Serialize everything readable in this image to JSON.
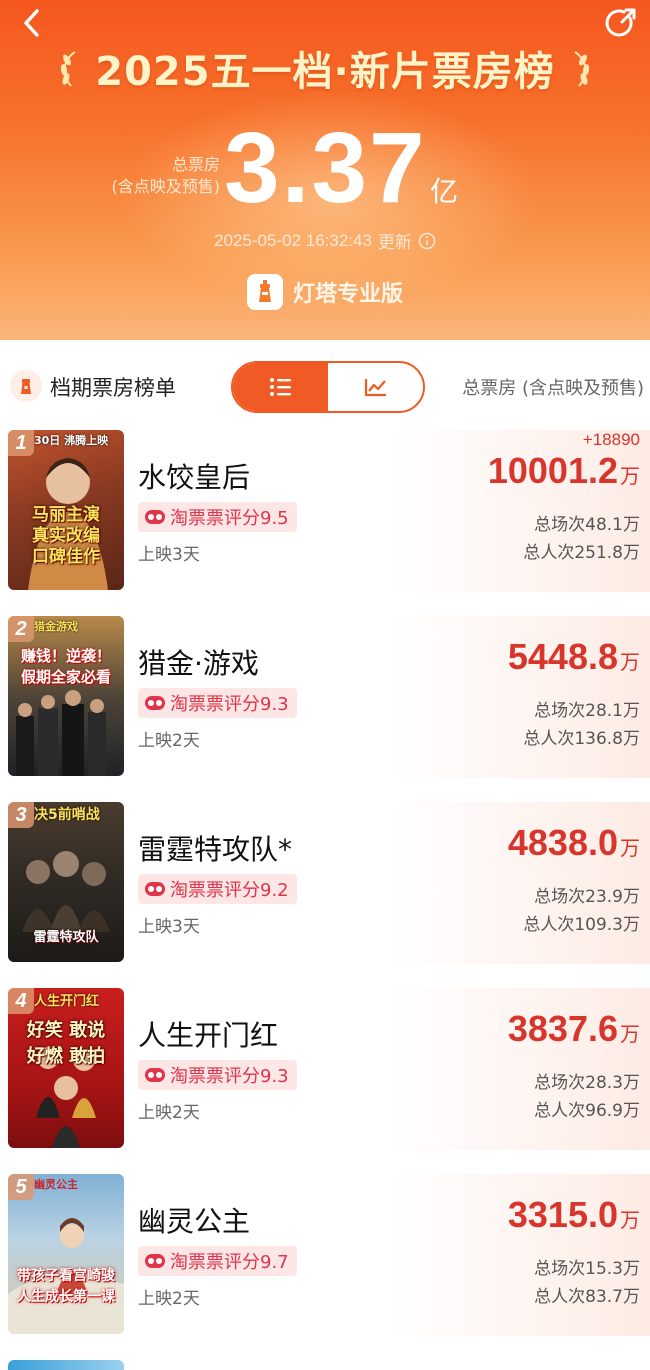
{
  "header": {
    "title": "2025五一档·新片票房榜",
    "total_label_line1": "总票房",
    "total_label_line2": "(含点映及预售)",
    "total_value": "3.37",
    "total_unit": "亿",
    "update_time": "2025-05-02 16:32:43",
    "update_label": "更新",
    "brand": "灯塔专业版"
  },
  "toolbar": {
    "title": "档期票房榜单",
    "column_header": "总票房 (含点映及预售)"
  },
  "colors": {
    "accent": "#f05a24",
    "gross_red": "#d8352c",
    "rating_pink": "#e0344a"
  },
  "movies": [
    {
      "rank": "1",
      "title": "水饺皇后",
      "rating": "淘票票评分9.5",
      "release": "上映3天",
      "delta": "+18890",
      "gross": "10001.2",
      "gross_unit": "万",
      "shows": "总场次48.1万",
      "admissions": "总人次251.8万",
      "poster_top": "30日 沸腾上映",
      "poster_tagline": "马丽主演\n真实改编\n口碑佳作"
    },
    {
      "rank": "2",
      "title": "猎金·游戏",
      "rating": "淘票票评分9.3",
      "release": "上映2天",
      "gross": "5448.8",
      "gross_unit": "万",
      "shows": "总场次28.1万",
      "admissions": "总人次136.8万",
      "poster_top": "猎金游戏",
      "poster_tagline": "赚钱！逆袭！\n假期全家必看"
    },
    {
      "rank": "3",
      "title": "雷霆特攻队*",
      "rating": "淘票票评分9.2",
      "release": "上映3天",
      "gross": "4838.0",
      "gross_unit": "万",
      "shows": "总场次23.9万",
      "admissions": "总人次109.3万",
      "poster_top": "决5前哨战",
      "poster_tagline": "雷霆特攻队"
    },
    {
      "rank": "4",
      "title": "人生开门红",
      "rating": "淘票票评分9.3",
      "release": "上映2天",
      "gross": "3837.6",
      "gross_unit": "万",
      "shows": "总场次28.3万",
      "admissions": "总人次96.9万",
      "poster_top": "人生开门红",
      "poster_tagline": "好笑 敢说\n好燃 敢拍"
    },
    {
      "rank": "5",
      "title": "幽灵公主",
      "rating": "淘票票评分9.7",
      "release": "上映2天",
      "gross": "3315.0",
      "gross_unit": "万",
      "shows": "总场次15.3万",
      "admissions": "总人次83.7万",
      "poster_top": "幽灵公主",
      "poster_tagline": "带孩子看宫崎骏\n人生成长第一课"
    }
  ]
}
